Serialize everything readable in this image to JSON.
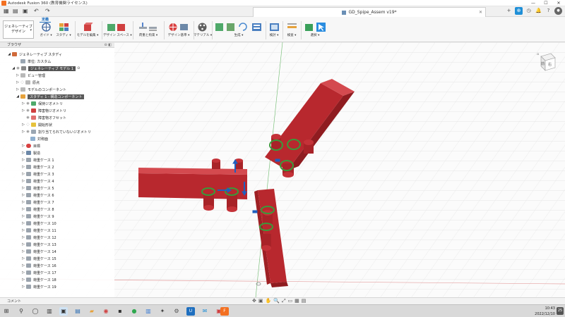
{
  "window": {
    "title": "Autodesk Fusion 360 (教育機関ライセンス)",
    "minimize": "—",
    "maximize": "☐",
    "close": "✕"
  },
  "document_tab": {
    "name": "GD_Spipe_Assem v19*",
    "close": "✕"
  },
  "workspace": {
    "label_line1": "ジェネレーティブ",
    "label_line2": "デザイン"
  },
  "ribbon": {
    "active_tab": "定義",
    "tools": [
      {
        "label": "ガイド ▾",
        "color": "#4a6fa5"
      },
      {
        "label": "スタディ ▾",
        "color": "#e8a13a"
      },
      {
        "label": "モデルを編集 ▾",
        "color": "#d04040"
      },
      {
        "label": "デザイン スペース ▾",
        "color": "#4fa96a"
      },
      {
        "label": "荷重と拘束 ▾",
        "color": "#9aa3ad"
      },
      {
        "label": "デザイン基準 ▾",
        "color": "#d84040"
      },
      {
        "label": "マテリアル ▾",
        "color": "#5f5f5f"
      },
      {
        "label": "生成 ▾",
        "color": "#4a8ad0"
      },
      {
        "label": "検討 ▾",
        "color": "#4a7fc0"
      },
      {
        "label": "検査 ▾",
        "color": "#e6a23c"
      },
      {
        "label": "選択 ▾",
        "color": "#2b8de0"
      }
    ]
  },
  "browser": {
    "title": "ブラウザ",
    "items": [
      {
        "label": "ジェネレーティブ スタディ",
        "style": ""
      },
      {
        "label": "単位: カスタム",
        "style": ""
      },
      {
        "label": "ジェネレーティブ モデル 1",
        "style": "hl"
      },
      {
        "label": "ビュー管理",
        "style": ""
      },
      {
        "label": "原点",
        "style": ""
      },
      {
        "label": "モデルのコンポーネント",
        "style": ""
      },
      {
        "label": "スタディ 1 - 構造コンポーネント",
        "style": "hl2"
      },
      {
        "label": "保持ジオメトリ",
        "style": ""
      },
      {
        "label": "障害物ジオメトリ",
        "style": ""
      },
      {
        "label": "障害物オフセット",
        "style": ""
      },
      {
        "label": "開始形状",
        "style": ""
      },
      {
        "label": "割り当てられていないジオメトリ",
        "style": ""
      },
      {
        "label": "対称面",
        "style": ""
      },
      {
        "label": "目標",
        "style": ""
      },
      {
        "label": "製造",
        "style": ""
      },
      {
        "label": "荷重ケース 1",
        "style": ""
      },
      {
        "label": "荷重ケース 2",
        "style": ""
      },
      {
        "label": "荷重ケース 3",
        "style": ""
      },
      {
        "label": "荷重ケース 4",
        "style": ""
      },
      {
        "label": "荷重ケース 5",
        "style": ""
      },
      {
        "label": "荷重ケース 6",
        "style": ""
      },
      {
        "label": "荷重ケース 7",
        "style": ""
      },
      {
        "label": "荷重ケース 8",
        "style": ""
      },
      {
        "label": "荷重ケース 9",
        "style": ""
      },
      {
        "label": "荷重ケース 10",
        "style": ""
      },
      {
        "label": "荷重ケース 11",
        "style": ""
      },
      {
        "label": "荷重ケース 12",
        "style": ""
      },
      {
        "label": "荷重ケース 13",
        "style": ""
      },
      {
        "label": "荷重ケース 14",
        "style": ""
      },
      {
        "label": "荷重ケース 15",
        "style": ""
      },
      {
        "label": "荷重ケース 16",
        "style": ""
      },
      {
        "label": "荷重ケース 17",
        "style": ""
      },
      {
        "label": "荷重ケース 18",
        "style": ""
      },
      {
        "label": "荷重ケース 19",
        "style": ""
      }
    ]
  },
  "viewcube": {
    "front": "前",
    "right": "右"
  },
  "navbar": {
    "comments": "コメント"
  },
  "taskbar": {
    "time": "10:43",
    "date": "2022/12/10",
    "notifications": "25"
  },
  "colors": {
    "part": "#b8282e",
    "retain": "#3a9a3a",
    "load": "#1f5fbf",
    "accent": "#1f8fd7"
  }
}
